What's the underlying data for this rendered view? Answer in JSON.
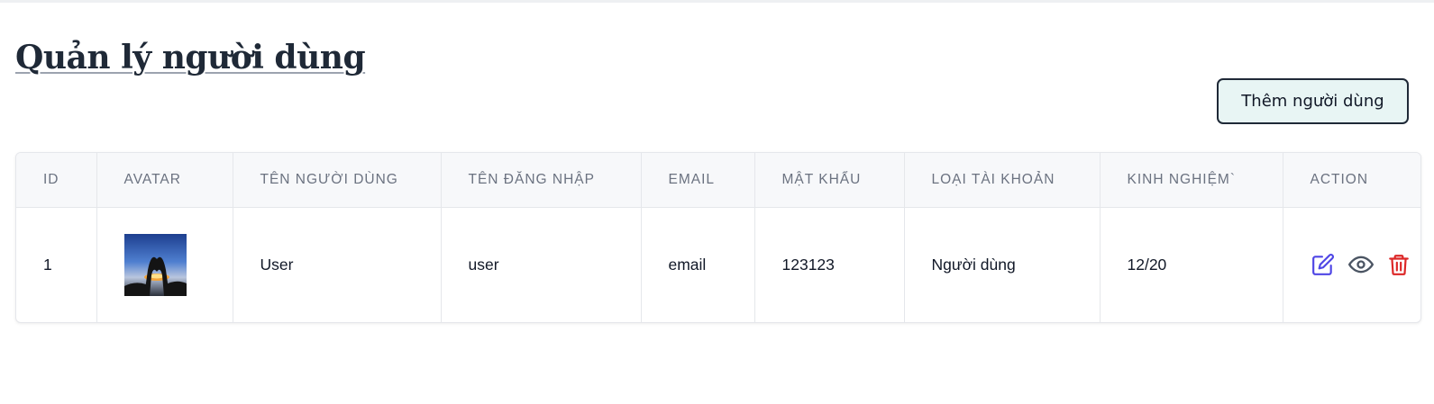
{
  "page": {
    "title": "Quản lý người dùng",
    "add_button_label": "Thêm người dùng"
  },
  "table": {
    "columns": [
      "ID",
      "AVATAR",
      "TÊN NGƯỜI DÙNG",
      "TÊN ĐĂNG NHẬP",
      "EMAIL",
      "MẬT KHẨU",
      "LOẠI TÀI KHOẢN",
      "KINH NGHIỆM`",
      "ACTION"
    ],
    "rows": [
      {
        "id": "1",
        "name": "User",
        "username": "user",
        "email": "email",
        "password": "123123",
        "account_type": "Người dùng",
        "experience": "12/20"
      }
    ]
  },
  "icons": {
    "edit": "edit-icon",
    "view": "eye-icon",
    "delete": "trash-icon"
  },
  "colors": {
    "edit": "#4f46e5",
    "view": "#4b5563",
    "delete": "#dc2626",
    "button_bg": "#e8f5f4"
  }
}
